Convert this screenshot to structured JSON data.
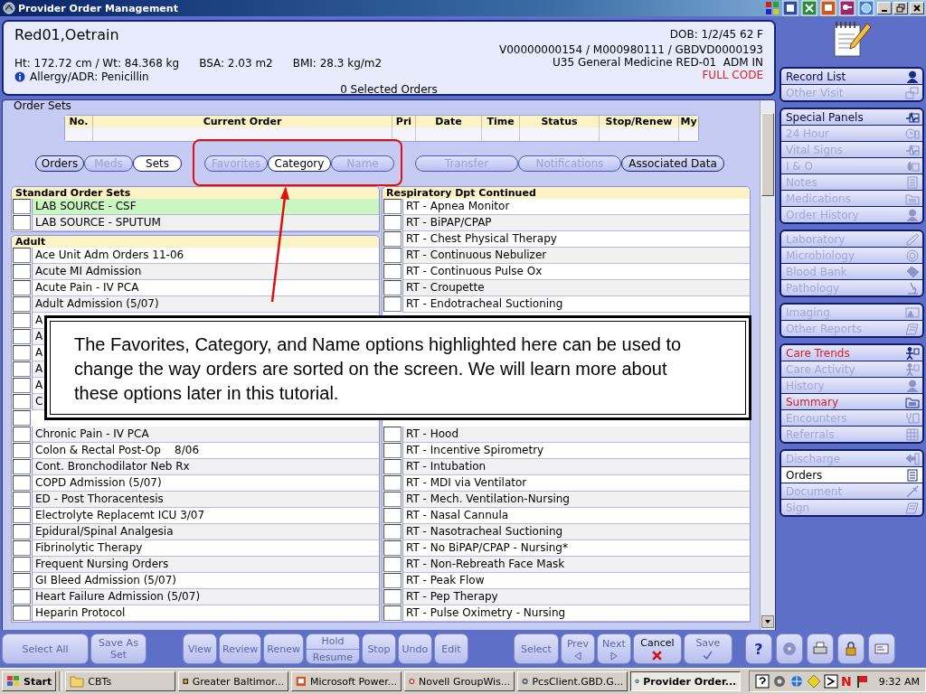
{
  "window": {
    "title": "Provider Order Management"
  },
  "patient": {
    "name": "Red01,Oetrain",
    "dob": "DOB: 1/2/45 62 F",
    "ids": "V00000000154 / M000980111 / GBDVD0000193",
    "height_weight": "Ht: 172.72 cm / Wt: 84.368 kg",
    "bsa": "BSA: 2.03 m2",
    "bmi": "BMI: 28.3 kg/m2",
    "unit": "U35 General Medicine RED-01  ADM IN",
    "allergy": "Allergy/ADR: Penicillin",
    "code_status": "FULL CODE",
    "selected_orders": "0 Selected Orders"
  },
  "order_sets": {
    "title": "Order Sets",
    "table": {
      "columns": [
        "No.",
        "Current Order",
        "Pri",
        "Date",
        "Time",
        "Status",
        "Stop/Renew",
        "My"
      ]
    },
    "view_buttons": [
      {
        "label": "Orders",
        "selected": false,
        "disabled": false
      },
      {
        "label": "Meds",
        "selected": false,
        "disabled": true
      },
      {
        "label": "Sets",
        "selected": true,
        "disabled": false
      }
    ],
    "sort_buttons": [
      {
        "label": "Favorites",
        "selected": false,
        "disabled": true
      },
      {
        "label": "Category",
        "selected": true,
        "disabled": false
      },
      {
        "label": "Name",
        "selected": false,
        "disabled": true
      }
    ],
    "action_buttons": [
      {
        "label": "Transfer",
        "selected": false,
        "disabled": true
      },
      {
        "label": "Notifications",
        "selected": false,
        "disabled": true
      },
      {
        "label": "Associated Data",
        "selected": false,
        "disabled": false
      }
    ],
    "left_sections": [
      {
        "title": "Standard Order Sets",
        "items": [
          {
            "label": "LAB SOURCE - CSF",
            "checked": false,
            "selected": true
          },
          {
            "label": "LAB SOURCE - SPUTUM",
            "checked": false,
            "selected": false
          }
        ]
      },
      {
        "title": "Adult",
        "items": [
          {
            "label": "Ace Unit Adm Orders 11-06",
            "checked": false,
            "selected": false
          },
          {
            "label": "Acute MI Admission",
            "checked": false,
            "selected": false
          },
          {
            "label": "Acute Pain - IV PCA",
            "checked": false,
            "selected": false
          },
          {
            "label": "Adult Admission (5/07)",
            "checked": false,
            "selected": false
          },
          {
            "label": "A",
            "checked": false,
            "selected": false
          },
          {
            "label": "A",
            "checked": false,
            "selected": false
          },
          {
            "label": "A",
            "checked": false,
            "selected": false
          },
          {
            "label": "A",
            "checked": false,
            "selected": false
          },
          {
            "label": "A",
            "checked": false,
            "selected": false
          },
          {
            "label": "C",
            "checked": false,
            "selected": false
          },
          {
            "checked": false
          },
          {
            "label": "Chronic Pain - IV PCA",
            "checked": false,
            "selected": false
          },
          {
            "label": "Colon & Rectal Post-Op    8/06",
            "checked": false,
            "selected": false
          },
          {
            "label": "Cont. Bronchodilator Neb Rx",
            "checked": false,
            "selected": false
          },
          {
            "label": "COPD Admission (5/07)",
            "checked": false,
            "selected": false
          },
          {
            "label": "ED - Post Thoracentesis",
            "checked": false,
            "selected": false
          },
          {
            "label": "Electrolyte Replacemt ICU 3/07",
            "checked": false,
            "selected": false
          },
          {
            "label": "Epidural/Spinal Analgesia",
            "checked": false,
            "selected": false
          },
          {
            "label": "Fibrinolytic Therapy",
            "checked": false,
            "selected": false
          },
          {
            "label": "Frequent Nursing Orders",
            "checked": false,
            "selected": false
          },
          {
            "label": "GI Bleed Admission (5/07)",
            "checked": false,
            "selected": false
          },
          {
            "label": "Heart Failure Admission (5/07)",
            "checked": false,
            "selected": false
          },
          {
            "label": "Heparin Protocol",
            "checked": false,
            "selected": false
          }
        ]
      }
    ],
    "right_section": {
      "title": "Respiratory Dpt Continued",
      "items": [
        {
          "label": "RT - Apnea Monitor",
          "checked": false,
          "selected": false
        },
        {
          "label": "RT - BiPAP/CPAP",
          "checked": false,
          "selected": false
        },
        {
          "label": "RT - Chest Physical Therapy",
          "checked": false,
          "selected": false
        },
        {
          "label": "RT - Continuous Nebulizer",
          "checked": false,
          "selected": false
        },
        {
          "label": "RT - Continuous Pulse Ox",
          "checked": false,
          "selected": false
        },
        {
          "label": "RT - Croupette",
          "checked": false,
          "selected": false
        },
        {
          "label": "RT - Endotracheal Suctioning",
          "checked": false,
          "selected": false
        }
      ],
      "items_after_callout": [
        {
          "label": "RT - Hood",
          "checked": false,
          "selected": false
        },
        {
          "label": "RT - Incentive Spirometry",
          "checked": false,
          "selected": false
        },
        {
          "label": "RT - Intubation",
          "checked": false,
          "selected": false
        },
        {
          "label": "RT - MDI via Ventilator",
          "checked": false,
          "selected": false
        },
        {
          "label": "RT - Mech. Ventilation-Nursing",
          "checked": false,
          "selected": false
        },
        {
          "label": "RT - Nasal Cannula",
          "checked": false,
          "selected": false
        },
        {
          "label": "RT - Nasotracheal Suctioning",
          "checked": false,
          "selected": false
        },
        {
          "label": "RT - No BiPAP/CPAP - Nursing*",
          "checked": false,
          "selected": false
        },
        {
          "label": "RT - Non-Rebreath Face Mask",
          "checked": false,
          "selected": false
        },
        {
          "label": "RT - Peak Flow",
          "checked": false,
          "selected": false
        },
        {
          "label": "RT - Pep Therapy",
          "checked": false,
          "selected": false
        },
        {
          "label": "RT - Pulse Oximetry - Nursing",
          "checked": false,
          "selected": false
        }
      ]
    }
  },
  "callout": {
    "text": "The Favorites, Category, and Name options highlighted here can be used to change the way orders are sorted on the screen. We will learn more about these options later in this tutorial."
  },
  "sidebar": {
    "groups": [
      {
        "items": [
          {
            "label": "Record List",
            "selected": false,
            "disabled": false,
            "flagged": false
          },
          {
            "label": "Other Visit",
            "selected": false,
            "disabled": true,
            "flagged": false
          }
        ]
      },
      {
        "items": [
          {
            "label": "Special Panels",
            "selected": false,
            "disabled": false,
            "flagged": false
          },
          {
            "label": "24 Hour",
            "selected": false,
            "disabled": true,
            "flagged": false
          },
          {
            "label": "Vital Signs",
            "selected": false,
            "disabled": true,
            "flagged": false
          },
          {
            "label": "I & O",
            "selected": false,
            "disabled": true,
            "flagged": false
          },
          {
            "label": "Notes",
            "selected": false,
            "disabled": true,
            "flagged": false
          },
          {
            "label": "Medications",
            "selected": false,
            "disabled": true,
            "flagged": false
          },
          {
            "label": "Order History",
            "selected": false,
            "disabled": true,
            "flagged": false
          }
        ]
      },
      {
        "items": [
          {
            "label": "Laboratory",
            "selected": false,
            "disabled": true,
            "flagged": false
          },
          {
            "label": "Microbiology",
            "selected": false,
            "disabled": true,
            "flagged": false
          },
          {
            "label": "Blood Bank",
            "selected": false,
            "disabled": true,
            "flagged": false
          },
          {
            "label": "Pathology",
            "selected": false,
            "disabled": true,
            "flagged": false
          }
        ]
      },
      {
        "items": [
          {
            "label": "Imaging",
            "selected": false,
            "disabled": true,
            "flagged": false
          },
          {
            "label": "Other Reports",
            "selected": false,
            "disabled": true,
            "flagged": false
          }
        ]
      },
      {
        "items": [
          {
            "label": "Care Trends",
            "selected": false,
            "disabled": false,
            "flagged": true
          },
          {
            "label": "Care Activity",
            "selected": false,
            "disabled": true,
            "flagged": false
          },
          {
            "label": "History",
            "selected": false,
            "disabled": true,
            "flagged": false
          },
          {
            "label": "Summary",
            "selected": false,
            "disabled": false,
            "flagged": true
          },
          {
            "label": "Encounters",
            "selected": false,
            "disabled": true,
            "flagged": false
          },
          {
            "label": "Referrals",
            "selected": false,
            "disabled": true,
            "flagged": false
          }
        ]
      },
      {
        "items": [
          {
            "label": "Discharge",
            "selected": false,
            "disabled": true,
            "flagged": false
          },
          {
            "label": "Orders",
            "selected": true,
            "disabled": false,
            "flagged": false
          },
          {
            "label": "Document",
            "selected": false,
            "disabled": true,
            "flagged": false
          },
          {
            "label": "Sign",
            "selected": false,
            "disabled": true,
            "flagged": false
          }
        ]
      }
    ]
  },
  "toolbar": {
    "left": [
      {
        "kind": "plain",
        "label": "Select All",
        "disabled": true
      },
      {
        "kind": "plain",
        "label": "Save As Set",
        "disabled": true
      }
    ],
    "middle": [
      {
        "kind": "plain",
        "label": "View",
        "disabled": true
      },
      {
        "kind": "plain",
        "label": "Review",
        "disabled": true
      },
      {
        "kind": "plain",
        "label": "Renew",
        "disabled": true
      },
      {
        "kind": "split",
        "label": "Hold",
        "label_2": "Resume",
        "disabled": true
      },
      {
        "kind": "plain",
        "label": "Stop",
        "disabled": true
      },
      {
        "kind": "plain",
        "label": "Undo",
        "disabled": true
      },
      {
        "kind": "plain",
        "label": "Edit",
        "disabled": true
      }
    ],
    "right": [
      {
        "kind": "plain",
        "label": "Select",
        "disabled": true
      },
      {
        "kind": "prev",
        "label": "Prev",
        "disabled": true
      },
      {
        "kind": "next",
        "label": "Next",
        "disabled": true
      },
      {
        "kind": "cancel",
        "label": "Cancel",
        "disabled": false
      },
      {
        "kind": "confirm",
        "label": "Save",
        "disabled": true
      }
    ],
    "tools": [
      {
        "kind": "help",
        "label": "?"
      },
      {
        "kind": "disc"
      },
      {
        "kind": "printer"
      },
      {
        "kind": "lock"
      },
      {
        "kind": "card"
      }
    ]
  },
  "taskbar": {
    "start": "Start",
    "tasks": [
      {
        "label": "CBTs",
        "selected": false
      },
      {
        "label": "Greater Baltimor...",
        "selected": false
      },
      {
        "label": "Microsoft Power...",
        "selected": false
      },
      {
        "label": "Novell GroupWis...",
        "selected": false
      },
      {
        "label": "PcsClient.GBD.G...",
        "selected": false
      },
      {
        "label": "Provider Order...",
        "selected": true
      }
    ],
    "tray_letter": "N",
    "clock": "9:32 AM"
  }
}
